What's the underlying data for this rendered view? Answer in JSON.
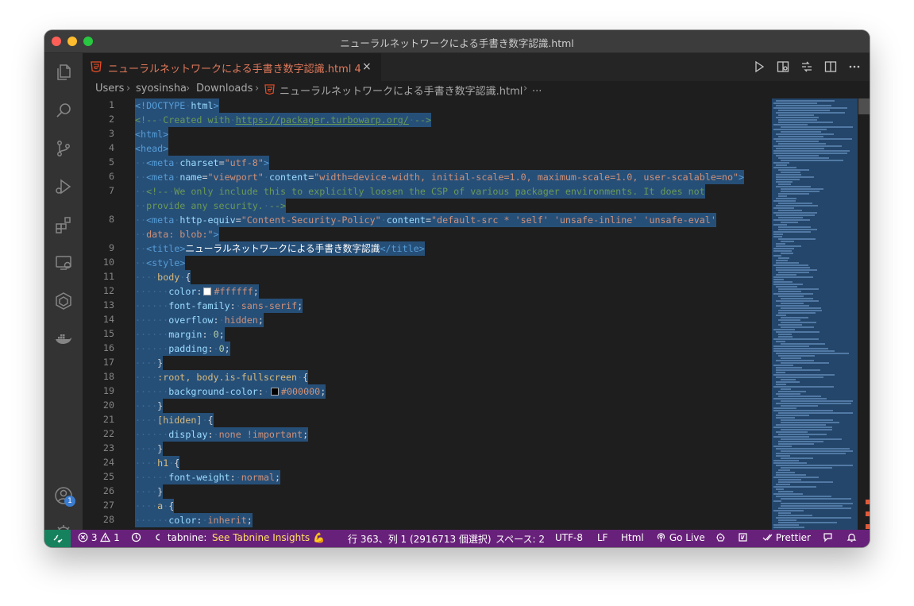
{
  "window": {
    "title": "ニューラルネットワークによる手書き数字認識.html"
  },
  "activity_bar": {
    "items": [
      "explorer-icon",
      "search-icon",
      "source-control-icon",
      "run-debug-icon",
      "extensions-icon",
      "remote-explorer-icon",
      "cube-icon",
      "docker-icon"
    ],
    "bottom_items": [
      "account-icon",
      "settings-gear-icon"
    ],
    "account_badge": "1"
  },
  "tab": {
    "label": "ニューラルネットワークによる手書き数字認識.html",
    "problems": "4",
    "close": "×"
  },
  "breadcrumb": {
    "parts": [
      "Users",
      "syosinsha",
      "Downloads",
      "ニューラルネットワークによる手書き数字認識.html",
      "..."
    ]
  },
  "editor": {
    "line_numbers": [
      "1",
      "2",
      "3",
      "4",
      "5",
      "6",
      "7",
      "",
      "8",
      "",
      "9",
      "10",
      "11",
      "12",
      "13",
      "14",
      "15",
      "16",
      "17",
      "18",
      "19",
      "20",
      "21",
      "22",
      "23",
      "24",
      "25",
      "26",
      "27",
      "28"
    ],
    "tokens": {
      "doctype": "<!DOCTYPE",
      "html_kw": "html",
      "gt": ">",
      "comment_start": "<!--",
      "created_with": "Created with",
      "url": "https://packager.turbowarp.org/",
      "comment_end": "-->",
      "html_open": "<html>",
      "head_open": "<head>",
      "meta": "<meta",
      "charset_attr": "charset",
      "charset_val": "\"utf-8\"",
      "name_attr": "name",
      "name_val": "\"viewport\"",
      "content_attr": "content",
      "content_val": "\"width=device-width, initial-scale=1.0, maximum-scale=1.0, user-scalable=no\"",
      "comment7a": "We only include this to explicitly loosen the CSP of various packager environments. It does not",
      "comment7b": "provide any security.",
      "equiv_attr": "http-equiv",
      "equiv_val": "\"Content-Security-Policy\"",
      "csp_val_a": "\"default-src * 'self' 'unsafe-inline' 'unsafe-eval'",
      "csp_val_b": "data: blob:\"",
      "title_open": "<title>",
      "title_text": "ニューラルネットワークによる手書き数字認識",
      "title_close": "</title>",
      "style_open": "<style>",
      "body_sel": "body",
      "brace_open": "{",
      "brace_close": "}",
      "color_prop": "color",
      "color_val": "#ffffff",
      "font_prop": "font-family",
      "font_val": "sans-serif",
      "overflow_prop": "overflow",
      "overflow_val": "hidden",
      "margin_prop": "margin",
      "zero": "0",
      "padding_prop": "padding",
      "root_sel": ":root, body.is-fullscreen",
      "bg_prop": "background-color",
      "bg_val": "#000000",
      "hidden_sel": "[hidden]",
      "display_prop": "display",
      "display_val": "none !important",
      "h1_sel": "h1",
      "fw_prop": "font-weight",
      "fw_val": "normal",
      "a_sel": "a",
      "inherit_val": "inherit"
    }
  },
  "status_bar": {
    "errors": "3",
    "warnings": "1",
    "tabnine": "tabnine:",
    "tabnine_link": "See Tabnine Insights 💪",
    "position": "行 363、列 1 (2916713 個選択)",
    "spaces": "スペース: 2",
    "encoding": "UTF-8",
    "eol": "LF",
    "language": "Html",
    "go_live": "Go Live",
    "prettier": "Prettier"
  },
  "colors": {
    "statusbar": "#68217a",
    "remote": "#16825d",
    "selection": "#264f78",
    "tab_label": "#e0795b"
  }
}
